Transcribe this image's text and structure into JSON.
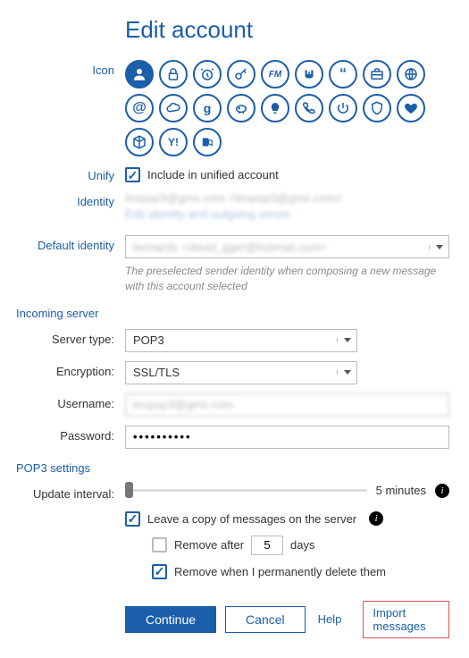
{
  "title": "Edit account",
  "labels": {
    "icon": "Icon",
    "unify": "Unify",
    "identity": "Identity",
    "default_identity": "Default identity",
    "server_type": "Server type:",
    "encryption": "Encryption:",
    "username": "Username:",
    "password": "Password:",
    "update_interval": "Update interval:"
  },
  "unify": {
    "include_label": "Include in unified account",
    "checked": true
  },
  "identity": {
    "line1": "leopop3@gmx.com <leopop3@gmx.com>",
    "edit_link": "Edit identity and outgoing server"
  },
  "default_identity": {
    "value": "leonardo <david_gger@hotmail.com>",
    "hint": "The preselected sender identity when composing a new message with this account selected"
  },
  "sections": {
    "incoming": "Incoming server",
    "pop3": "POP3 settings"
  },
  "server": {
    "type": "POP3",
    "encryption": "SSL/TLS",
    "username": "leopop3@gmx.com",
    "password": "••••••••••"
  },
  "pop3": {
    "interval_label": "5 minutes",
    "leave_copy": {
      "label": "Leave a copy of messages on the server",
      "checked": true
    },
    "remove_after": {
      "checked": false,
      "prefix": "Remove after",
      "days": "5",
      "suffix": "days"
    },
    "remove_perm": {
      "checked": true,
      "label": "Remove when I permanently delete them"
    }
  },
  "buttons": {
    "continue": "Continue",
    "cancel": "Cancel",
    "help": "Help",
    "import": "Import messages"
  }
}
